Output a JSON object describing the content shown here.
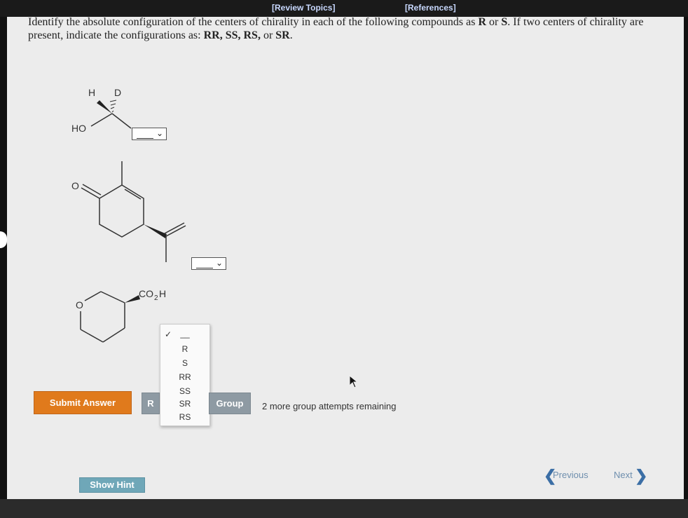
{
  "header": {
    "review_topics": "[Review Topics]",
    "references": "[References]"
  },
  "question": {
    "part1": "Identify the absolute configuration of the centers of chirality in each of the following compounds as ",
    "r": "R",
    "or": " or ",
    "s": "S",
    "part2": ". If two centers of chirality are present, indicate the configurations as: ",
    "options": "RR, SS, RS,",
    "or2": " or ",
    "sr": "SR",
    "end": "."
  },
  "molecules": {
    "m1": {
      "h": "H",
      "d": "D",
      "ho": "HO"
    },
    "m2": {
      "o": "O"
    },
    "m3": {
      "o": "O",
      "co2h": "CO",
      "sub2": "2",
      "h": "H"
    }
  },
  "dropdown": {
    "checkmark": "✓",
    "options": [
      "__",
      "R",
      "S",
      "RR",
      "SS",
      "SR",
      "RS"
    ]
  },
  "buttons": {
    "submit": "Submit Answer",
    "retry_partial": "R",
    "group": "Group",
    "show_hint": "Show Hint"
  },
  "status": {
    "attempts": "2 more group attempts remaining"
  },
  "navigation": {
    "previous": "Previous",
    "next": "Next"
  },
  "colors": {
    "submit": "#e07a1c",
    "hint": "#6fa7b8",
    "gray_button": "#8e9aa3",
    "link": "#3b6ea5"
  }
}
